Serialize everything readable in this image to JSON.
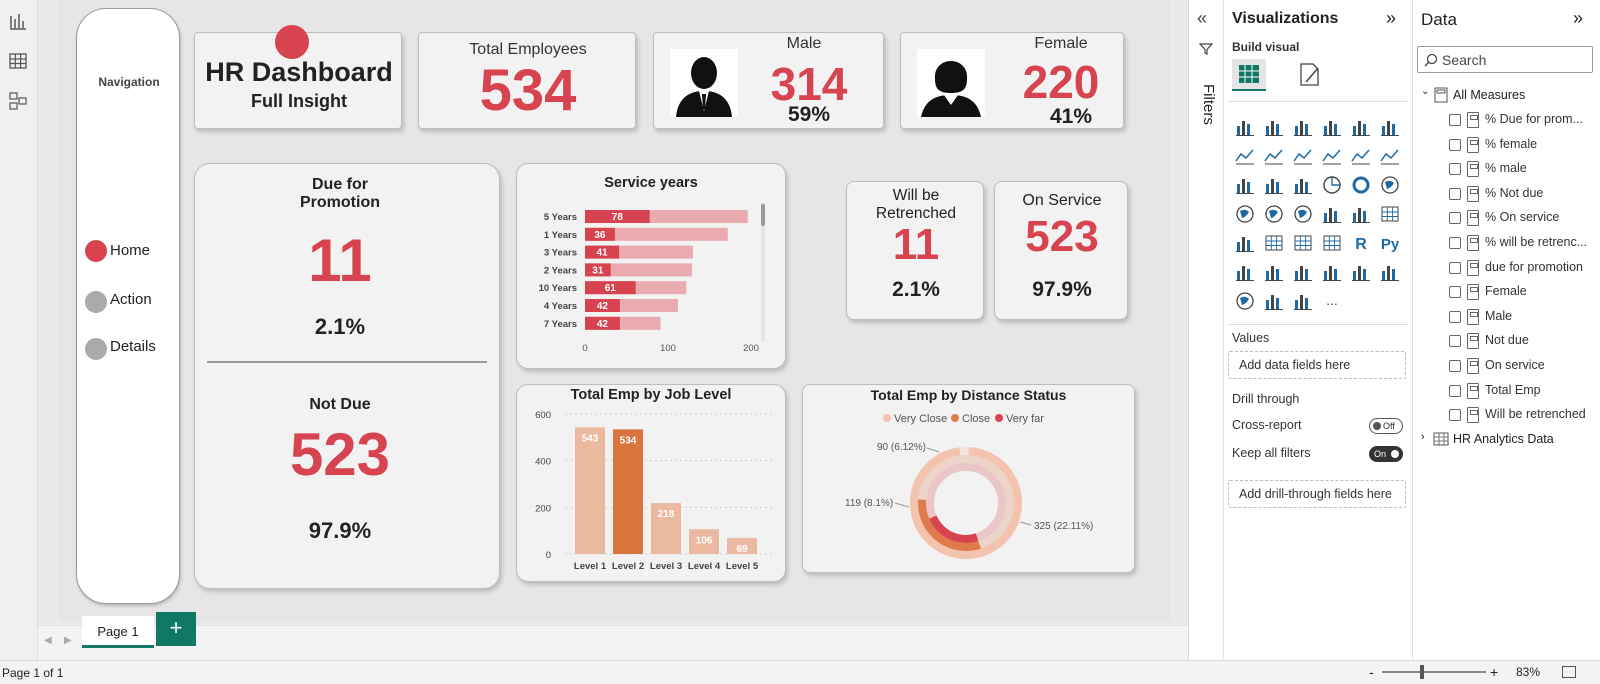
{
  "dashboard": {
    "nav": {
      "title": "Navigation",
      "items": [
        "Home",
        "Action",
        "Details"
      ]
    },
    "header": {
      "title": "HR Dashboard",
      "subtitle": "Full Insight"
    },
    "total": {
      "label": "Total Employees",
      "value": "534"
    },
    "male": {
      "label": "Male",
      "value": "314",
      "pct": "59%"
    },
    "female": {
      "label": "Female",
      "value": "220",
      "pct": "41%"
    },
    "due": {
      "label1": "Due for",
      "label2": "Promotion",
      "value": "11",
      "pct": "2.1%"
    },
    "notdue": {
      "label": "Not Due",
      "value": "523",
      "pct": "97.9%"
    },
    "retrench": {
      "label1": "Will be",
      "label2": "Retrenched",
      "value": "11",
      "pct": "2.1%"
    },
    "onservice": {
      "label": "On Service",
      "value": "523",
      "pct": "97.9%"
    }
  },
  "chart_data": [
    {
      "type": "bar",
      "title": "Service years",
      "categories": [
        "5 Years",
        "1 Years",
        "3 Years",
        "2 Years",
        "10 Years",
        "4 Years",
        "7 Years"
      ],
      "series": [
        {
          "values": [
            78,
            36,
            41,
            31,
            61,
            42,
            42
          ]
        },
        {
          "values": [
            196,
            172,
            130,
            129,
            122,
            112,
            91
          ]
        }
      ],
      "xticks": [
        "0",
        "100",
        "200"
      ],
      "xlim": [
        0,
        200
      ]
    },
    {
      "type": "bar",
      "title": "Total Emp by Job Level",
      "categories": [
        "Level 1",
        "Level 2",
        "Level 3",
        "Level 4",
        "Level 5"
      ],
      "values": [
        543,
        534,
        218,
        106,
        69
      ],
      "value_labels": [
        "543",
        "534",
        "218",
        "106",
        "69"
      ],
      "yticks": [
        "0",
        "200",
        "400",
        "600"
      ],
      "ylim": [
        0,
        600
      ]
    },
    {
      "type": "pie",
      "title": "Total Emp by Distance Status",
      "legend": [
        "Very Close",
        "Close",
        "Very far"
      ],
      "values": [
        325,
        119,
        90
      ],
      "slice_labels": [
        "325 (22.11%)",
        "119 (8.1%)",
        "90 (6.12%)"
      ],
      "colors": [
        "#f3c3ad",
        "#e07a4a",
        "#d7434f"
      ]
    }
  ],
  "bottom": {
    "page_tab": "Page 1",
    "add": "+",
    "status": "Page 1 of 1",
    "zoom": "83%",
    "minus": "-",
    "plus": "+"
  },
  "filters": {
    "label": "Filters"
  },
  "viz_pane": {
    "title": "Visualizations",
    "build": "Build visual",
    "values_label": "Values",
    "values_placeholder": "Add data fields here",
    "drill": "Drill through",
    "cross_report": "Cross-report",
    "cross_state": "Off",
    "keep_filters": "Keep all filters",
    "keep_state": "On",
    "drill_placeholder": "Add drill-through fields here",
    "more": "...",
    "r": "R",
    "py": "Py"
  },
  "data_pane": {
    "title": "Data",
    "search_placeholder": "Search",
    "group": "All Measures",
    "fields": [
      "% Due for prom...",
      "% female",
      "% male",
      "% Not due",
      "% On service",
      "% will be retrenc...",
      "due for promotion",
      "Female",
      "Male",
      "Not due",
      "On service",
      "Total Emp",
      "Will be retrenched"
    ],
    "table2": "HR Analytics Data"
  },
  "colors": {
    "accent": "#d7434f",
    "light_bar": "#e9aab0",
    "level1": "#eab9a0",
    "level2": "#d8753f"
  }
}
